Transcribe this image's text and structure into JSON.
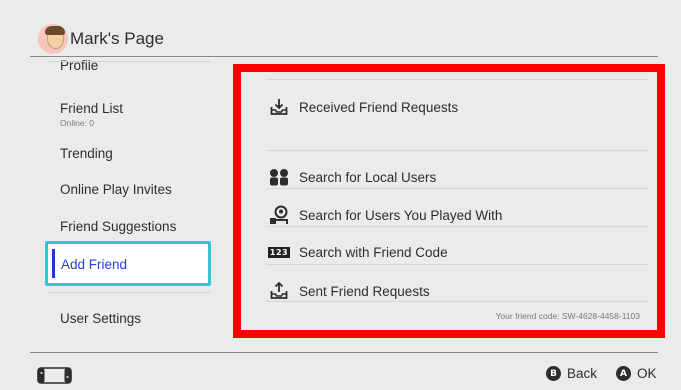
{
  "header": {
    "title": "Mark's Page"
  },
  "sidebar": {
    "items": [
      {
        "label": "Profile"
      },
      {
        "label": "Friend List",
        "sub": "Online: 0"
      },
      {
        "label": "Trending"
      },
      {
        "label": "Online Play Invites"
      },
      {
        "label": "Friend Suggestions"
      },
      {
        "label": "Add Friend"
      },
      {
        "label": "User Settings"
      }
    ],
    "selected": "Add Friend"
  },
  "main": {
    "options": [
      {
        "label": "Received Friend Requests",
        "icon": "inbox-download-icon"
      },
      {
        "label": "Search for Local Users",
        "icon": "two-users-icon"
      },
      {
        "label": "Search for Users You Played With",
        "icon": "user-history-icon"
      },
      {
        "label": "Search with Friend Code",
        "icon": "code-123-icon",
        "badge": "123"
      },
      {
        "label": "Sent Friend Requests",
        "icon": "outbox-upload-icon"
      }
    ],
    "friend_code": "Your friend code: SW-4628-4458-1103"
  },
  "footer": {
    "back": {
      "key": "B",
      "label": "Back"
    },
    "ok": {
      "key": "A",
      "label": "OK"
    }
  },
  "colors": {
    "background": "#ebebeb",
    "highlight_border": "#ff0000",
    "selection_border": "#2ec7d4",
    "selection_text": "#2940d8"
  }
}
